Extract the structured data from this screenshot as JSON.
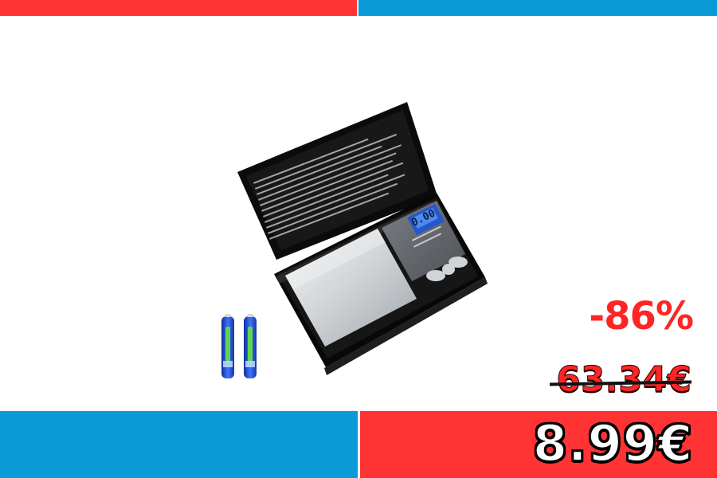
{
  "colors": {
    "blue": "#0a9ad8",
    "red": "#ff3333",
    "accent_red": "#ff2525",
    "scale_black": "#101010",
    "steel": "#cfd3d6",
    "lcd_blue": "#2f68d8",
    "battery_blue": "#1f4dd1",
    "battery_green": "#4cc84a"
  },
  "promo": {
    "discount": "-86%",
    "old_price": "63.34€",
    "new_price": "8.99€"
  },
  "icons": {
    "product": "digital-pocket-scale-icon",
    "batteries": "aaa-battery-icon"
  }
}
